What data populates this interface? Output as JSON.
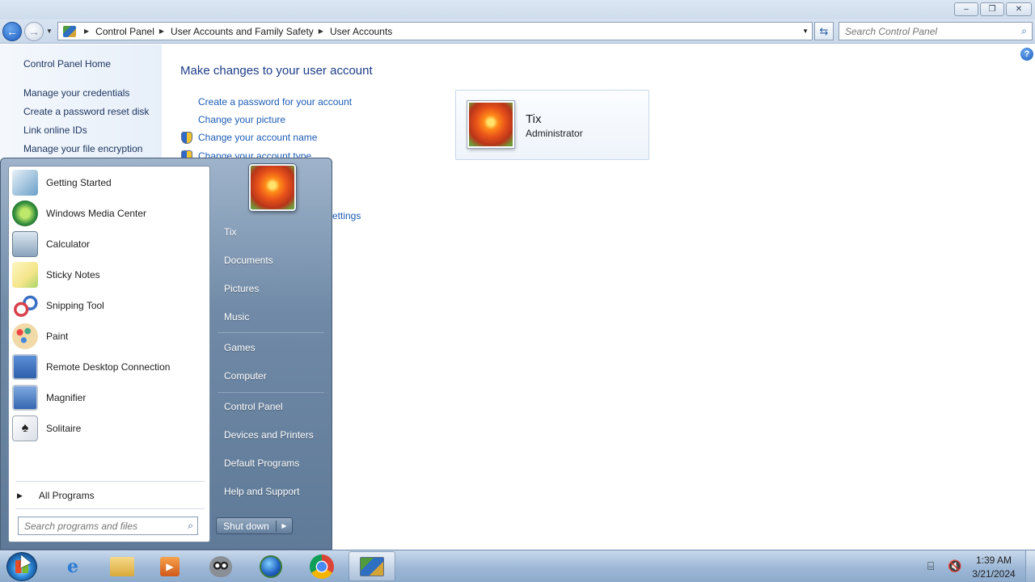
{
  "window": {
    "controls": {
      "minimize": "–",
      "maximize": "❐",
      "close": "✕"
    }
  },
  "addressbar": {
    "breadcrumbs": [
      "Control Panel",
      "User Accounts and Family Safety",
      "User Accounts"
    ],
    "search_placeholder": "Search Control Panel"
  },
  "leftpane": {
    "home": "Control Panel Home",
    "links": [
      "Manage your credentials",
      "Create a password reset disk",
      "Link online IDs",
      "Manage your file encryption"
    ]
  },
  "content": {
    "title": "Make changes to your user account",
    "tasks": [
      "Create a password for your account",
      "Change your picture",
      "Change your account name",
      "Change your account type"
    ],
    "partial_link": "ettings"
  },
  "user": {
    "name": "Tix",
    "role": "Administrator"
  },
  "startmenu": {
    "programs": [
      {
        "label": "Getting Started",
        "icon": "getting-started-icon",
        "color": "#6aa0c8"
      },
      {
        "label": "Windows Media Center",
        "icon": "windows-media-center-icon",
        "color": "#2f8a3a"
      },
      {
        "label": "Calculator",
        "icon": "calculator-icon",
        "color": "#8aa4bc"
      },
      {
        "label": "Sticky Notes",
        "icon": "sticky-notes-icon",
        "color": "#f4e58a"
      },
      {
        "label": "Snipping Tool",
        "icon": "snipping-tool-icon",
        "color": "#d8404a"
      },
      {
        "label": "Paint",
        "icon": "paint-icon",
        "color": "#e1b04a"
      },
      {
        "label": "Remote Desktop Connection",
        "icon": "remote-desktop-icon",
        "color": "#2f5faa"
      },
      {
        "label": "Magnifier",
        "icon": "magnifier-icon",
        "color": "#3466b0"
      },
      {
        "label": "Solitaire",
        "icon": "solitaire-icon",
        "color": "#d9dee6"
      }
    ],
    "all_programs": "All Programs",
    "search_placeholder": "Search programs and files",
    "places": [
      "Tix",
      "Documents",
      "Pictures",
      "Music",
      "Games",
      "Computer",
      "Control Panel",
      "Devices and Printers",
      "Default Programs",
      "Help and Support"
    ],
    "shutdown": "Shut down"
  },
  "taskbar": {
    "apps": [
      "internet-explorer-icon",
      "windows-explorer-icon",
      "media-player-icon",
      "raccoon-app-icon",
      "globe-app-icon",
      "chrome-icon",
      "control-panel-icon"
    ],
    "time": "1:39 AM",
    "date": "3/21/2024"
  }
}
